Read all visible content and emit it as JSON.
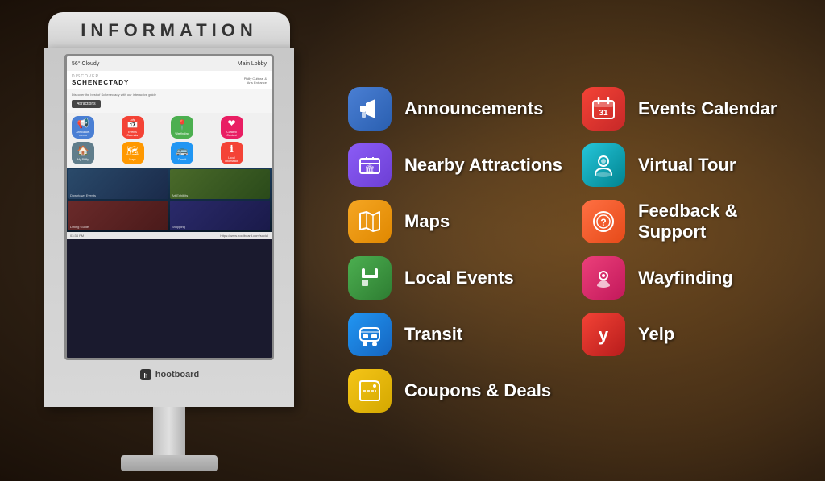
{
  "kiosk": {
    "title": "INFORMATION",
    "brand": "hootboard",
    "screen": {
      "location_name": "DISCOVER\nSCHENECTADY",
      "weather": "56° Cloudy",
      "location": "Main Lobby",
      "sublocation": "Philly Cultural & Arts Entrance",
      "explore_btn": "Attractions",
      "footer_time": "03:34 PM",
      "footer_url": "Read more or post yours at https://www.hootboard.com/social"
    },
    "mini_icons": [
      {
        "label": "Announcements",
        "color": "#4a7fd4"
      },
      {
        "label": "Events Calendar",
        "color": "#f44336"
      },
      {
        "label": "Wayfinding",
        "color": "#4caf50"
      },
      {
        "label": "Curated Content",
        "color": "#e91e63"
      },
      {
        "label": "My Philly",
        "color": "#607d8b"
      },
      {
        "label": "Maps",
        "color": "#ff9800"
      },
      {
        "label": "Transit",
        "color": "#2196f3"
      },
      {
        "label": "Local Information",
        "color": "#f44336"
      }
    ]
  },
  "menu": {
    "items_left": [
      {
        "id": "announcements",
        "label": "Announcements",
        "icon": "📢",
        "icon_class": "icon-blue"
      },
      {
        "id": "nearby-attractions",
        "label": "Nearby Attractions",
        "icon": "🏛",
        "icon_class": "icon-purple"
      },
      {
        "id": "maps",
        "label": "Maps",
        "icon": "🗺",
        "icon_class": "icon-yellow"
      },
      {
        "id": "local-events",
        "label": "Local Events",
        "icon": "🎪",
        "icon_class": "icon-green"
      },
      {
        "id": "transit",
        "label": "Transit",
        "icon": "🚌",
        "icon_class": "icon-blue2"
      },
      {
        "id": "coupons-deals",
        "label": "Coupons & Deals",
        "icon": "🏷",
        "icon_class": "icon-yellow2"
      }
    ],
    "items_right": [
      {
        "id": "events-calendar",
        "label": "Events Calendar",
        "icon": "📅",
        "icon_class": "icon-red-cal"
      },
      {
        "id": "virtual-tour",
        "label": "Virtual Tour",
        "icon": "👤",
        "icon_class": "icon-teal"
      },
      {
        "id": "feedback-support",
        "label": "Feedback & Support",
        "icon": "🆘",
        "icon_class": "icon-orange"
      },
      {
        "id": "wayfinding",
        "label": "Wayfinding",
        "icon": "📍",
        "icon_class": "icon-pink"
      },
      {
        "id": "yelp",
        "label": "Yelp",
        "icon": "❤",
        "icon_class": "icon-red-yelp"
      }
    ]
  }
}
